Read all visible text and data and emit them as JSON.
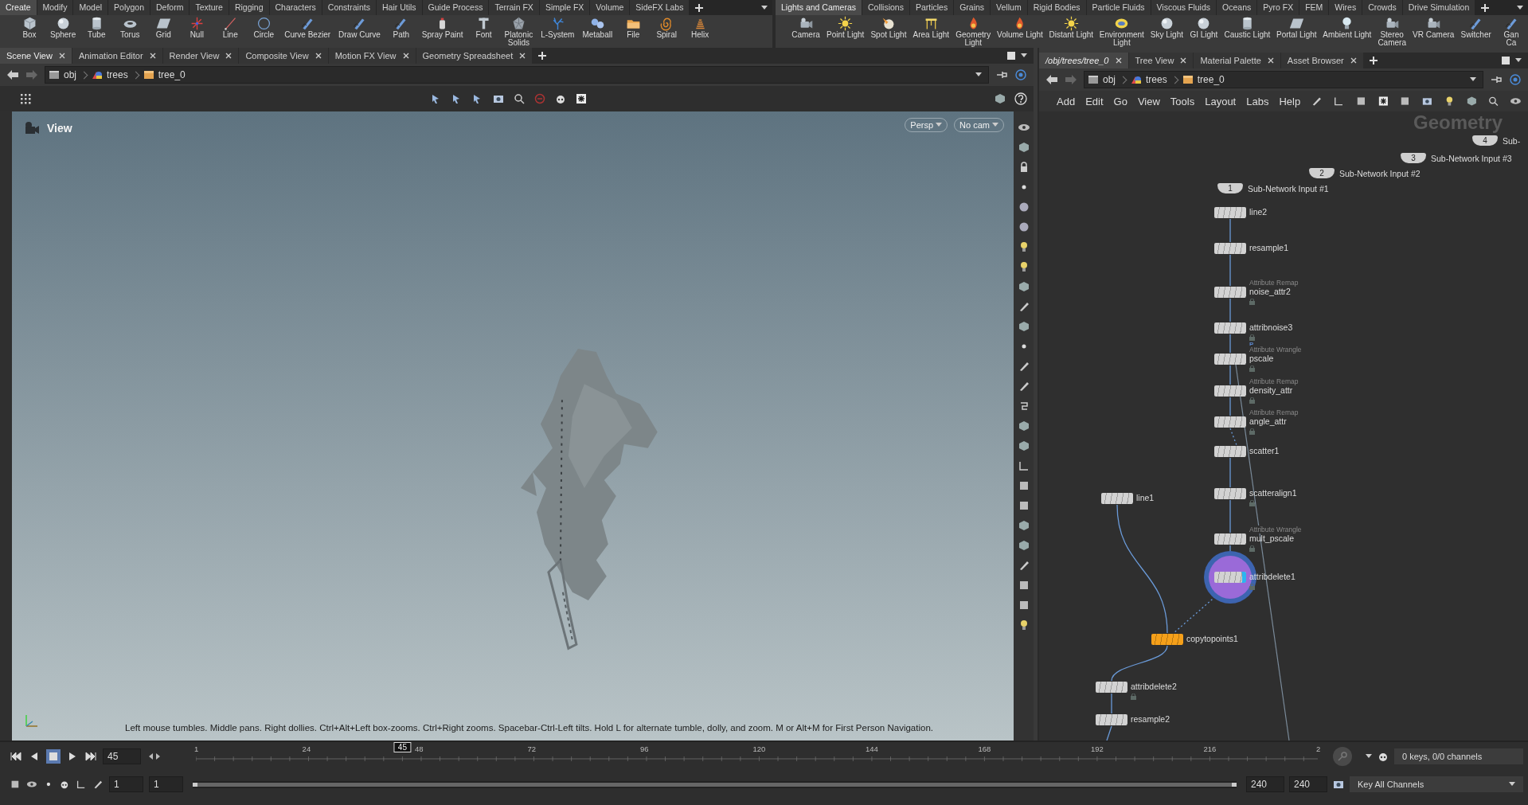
{
  "shelf_left": {
    "tabs": [
      {
        "label": "Create",
        "selected": true
      },
      {
        "label": "Modify",
        "selected": false
      },
      {
        "label": "Model",
        "selected": false
      },
      {
        "label": "Polygon",
        "selected": false
      },
      {
        "label": "Deform",
        "selected": false
      },
      {
        "label": "Texture",
        "selected": false
      },
      {
        "label": "Rigging",
        "selected": false
      },
      {
        "label": "Characters",
        "selected": false
      },
      {
        "label": "Constraints",
        "selected": false
      },
      {
        "label": "Hair Utils",
        "selected": false
      },
      {
        "label": "Guide Process",
        "selected": false
      },
      {
        "label": "Terrain FX",
        "selected": false
      },
      {
        "label": "Simple FX",
        "selected": false
      },
      {
        "label": "Volume",
        "selected": false
      },
      {
        "label": "SideFX Labs",
        "selected": false
      }
    ],
    "tools": [
      "Box",
      "Sphere",
      "Tube",
      "Torus",
      "Grid",
      "Null",
      "Line",
      "Circle",
      "Curve Bezier",
      "Draw Curve",
      "Path",
      "Spray Paint",
      "Font",
      "Platonic\nSolids",
      "L-System",
      "Metaball",
      "File",
      "Spiral",
      "Helix"
    ]
  },
  "shelf_right": {
    "tabs": [
      {
        "label": "Lights and Cameras",
        "selected": true
      },
      {
        "label": "Collisions",
        "selected": false
      },
      {
        "label": "Particles",
        "selected": false
      },
      {
        "label": "Grains",
        "selected": false
      },
      {
        "label": "Vellum",
        "selected": false
      },
      {
        "label": "Rigid Bodies",
        "selected": false
      },
      {
        "label": "Particle Fluids",
        "selected": false
      },
      {
        "label": "Viscous Fluids",
        "selected": false
      },
      {
        "label": "Oceans",
        "selected": false
      },
      {
        "label": "Pyro FX",
        "selected": false
      },
      {
        "label": "FEM",
        "selected": false
      },
      {
        "label": "Wires",
        "selected": false
      },
      {
        "label": "Crowds",
        "selected": false
      },
      {
        "label": "Drive Simulation",
        "selected": false
      }
    ],
    "tools": [
      "Camera",
      "Point Light",
      "Spot Light",
      "Area Light",
      "Geometry\nLight",
      "Volume Light",
      "Distant Light",
      "Environment\nLight",
      "Sky Light",
      "GI Light",
      "Caustic Light",
      "Portal Light",
      "Ambient Light",
      "Stereo\nCamera",
      "VR Camera",
      "Switcher",
      "Gan\nCa"
    ]
  },
  "scene_pane": {
    "tabs": [
      {
        "label": "Scene View",
        "selected": true
      },
      {
        "label": "Animation Editor",
        "selected": false
      },
      {
        "label": "Render View",
        "selected": false
      },
      {
        "label": "Composite View",
        "selected": false
      },
      {
        "label": "Motion FX View",
        "selected": false
      },
      {
        "label": "Geometry Spreadsheet",
        "selected": false
      }
    ],
    "path": [
      "obj",
      "trees",
      "tree_0"
    ],
    "viewport": {
      "title": "View",
      "camera_menus": [
        "Persp",
        "No cam"
      ],
      "hint": "Left mouse tumbles. Middle pans. Right dollies. Ctrl+Alt+Left box-zooms. Ctrl+Right zooms. Spacebar-Ctrl-Left tilts. Hold L for alternate tumble, dolly, and zoom. M or Alt+M for First Person Navigation."
    }
  },
  "network_pane": {
    "tabs": [
      {
        "label": "/obj/trees/tree_0",
        "selected": true
      },
      {
        "label": "Tree View",
        "selected": false
      },
      {
        "label": "Material Palette",
        "selected": false
      },
      {
        "label": "Asset Browser",
        "selected": false
      }
    ],
    "path": [
      "obj",
      "trees",
      "tree_0"
    ],
    "menu": [
      "Add",
      "Edit",
      "Go",
      "View",
      "Tools",
      "Layout",
      "Labs",
      "Help"
    ],
    "network_type": "Geometry",
    "nodes": [
      {
        "kind": "input",
        "number": "4",
        "name": "Sub-"
      },
      {
        "kind": "input",
        "number": "3",
        "name": "Sub-Network Input #3"
      },
      {
        "kind": "input",
        "number": "2",
        "name": "Sub-Network Input #2"
      },
      {
        "kind": "input",
        "number": "1",
        "name": "Sub-Network Input #1"
      },
      {
        "kind": "sop",
        "name": "line2",
        "color": "#d2d2d2",
        "display": false
      },
      {
        "kind": "sop",
        "name": "resample1",
        "color": "#d2d2d2",
        "display": false
      },
      {
        "kind": "sop",
        "name": "noise_attr2",
        "type_label": "Attribute Remap",
        "color": "#d2d2d2",
        "locked": true,
        "display": false
      },
      {
        "kind": "sop",
        "name": "attribnoise3",
        "note": "P",
        "color": "#d2d2d2",
        "locked": true,
        "display": false
      },
      {
        "kind": "sop",
        "name": "pscale",
        "type_label": "Attribute Wrangle",
        "color": "#d2d2d2",
        "locked": true,
        "display": false
      },
      {
        "kind": "sop",
        "name": "density_attr",
        "type_label": "Attribute Remap",
        "color": "#d2d2d2",
        "locked": true,
        "display": false
      },
      {
        "kind": "sop",
        "name": "angle_attr",
        "type_label": "Attribute Remap",
        "color": "#d2d2d2",
        "locked": true,
        "display": false
      },
      {
        "kind": "sop",
        "name": "scatter1",
        "color": "#d2d2d2",
        "display": false
      },
      {
        "kind": "sop",
        "name": "scatteralign1",
        "color": "#d2d2d2",
        "locked": true,
        "display": false
      },
      {
        "kind": "sop",
        "name": "mult_pscale",
        "type_label": "Attribute Wrangle",
        "color": "#d2d2d2",
        "locked": true,
        "display": false
      },
      {
        "kind": "sop",
        "name": "attribdelete1",
        "color": "#d2d2d2",
        "locked": true,
        "display": true
      },
      {
        "kind": "sop",
        "name": "line1",
        "color": "#d2d2d2",
        "display": false
      },
      {
        "kind": "sop",
        "name": "copytopoints1",
        "color": "#f5a01a",
        "display": false
      },
      {
        "kind": "sop",
        "name": "attribdelete2",
        "color": "#d2d2d2",
        "locked": true,
        "display": false
      },
      {
        "kind": "sop",
        "name": "resample2",
        "color": "#d2d2d2",
        "display": false
      }
    ]
  },
  "timeline": {
    "range": {
      "level": 1
    },
    "current_frame": "45",
    "marker": "45",
    "ruler_labels": [
      "1",
      "24",
      "48",
      "72",
      "96",
      "120",
      "144",
      "168",
      "192",
      "216",
      "2"
    ],
    "start_fields": [
      "1",
      "1"
    ],
    "end_fields": [
      "240",
      "240"
    ],
    "keys_info": "0 keys, 0/0 channels",
    "key_menu": "Key All Channels"
  }
}
